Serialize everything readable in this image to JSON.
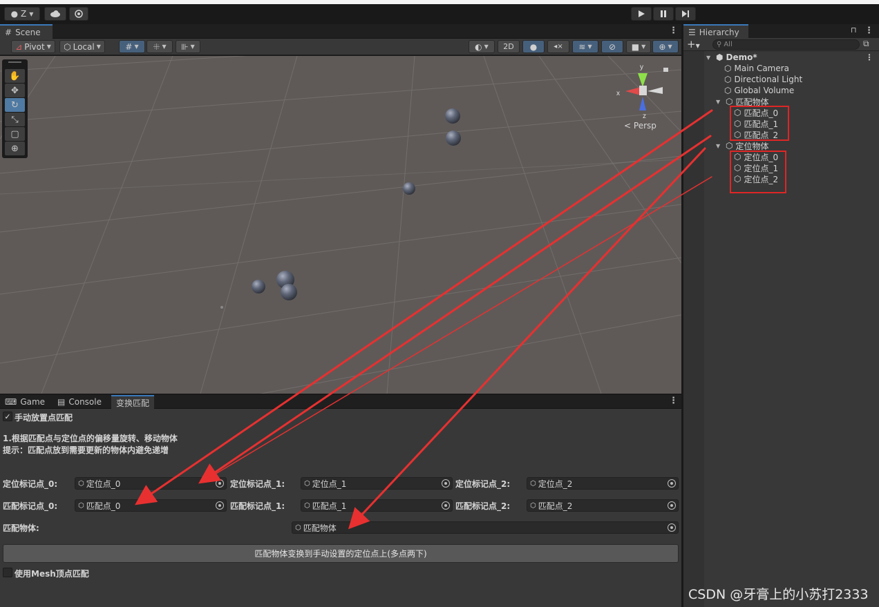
{
  "toolbar": {
    "account_label": "Z",
    "cloud_icon": "cloud-icon",
    "settings_icon": "gear-icon",
    "play_icon": "play-icon",
    "pause_icon": "pause-icon",
    "step_icon": "step-icon"
  },
  "scene_tab": {
    "label": "Scene"
  },
  "scene_toolbar": {
    "pivot_label": "Pivot",
    "local_label": "Local",
    "mode_2d_label": "2D"
  },
  "scene": {
    "gizmo_y": "y",
    "gizmo_x": "x",
    "gizmo_z": "z",
    "persp_label": "Persp"
  },
  "bottom_tabs": [
    {
      "label": "Game"
    },
    {
      "label": "Console"
    },
    {
      "label": "变换匹配"
    }
  ],
  "panel": {
    "manual_toggle_label": "手动放置点匹配",
    "manual_toggle_checked": true,
    "desc_line1": "1.根据匹配点与定位点的偏移量旋转、移动物体",
    "desc_line2": "提示：匹配点放到需要更新的物体内避免递增",
    "locate_row": [
      {
        "label": "定位标记点_0:",
        "value": "定位点_0"
      },
      {
        "label": "定位标记点_1:",
        "value": "定位点_1"
      },
      {
        "label": "定位标记点_2:",
        "value": "定位点_2"
      }
    ],
    "match_row": [
      {
        "label": "匹配标记点_0:",
        "value": "匹配点_0"
      },
      {
        "label": "匹配标记点_1:",
        "value": "匹配点_1"
      },
      {
        "label": "匹配标记点_2:",
        "value": "匹配点_2"
      }
    ],
    "match_object_label": "匹配物体:",
    "match_object_value": "匹配物体",
    "transform_button_label": "匹配物体变换到手动设置的定位点上(多点两下)",
    "mesh_toggle_label": "使用Mesh顶点匹配",
    "mesh_toggle_checked": false
  },
  "hierarchy": {
    "tab_label": "Hierarchy",
    "search_placeholder": "All",
    "scene_name": "Demo*",
    "items": [
      {
        "label": "Main Camera"
      },
      {
        "label": "Directional Light"
      },
      {
        "label": "Global Volume"
      },
      {
        "label": "匹配物体"
      },
      {
        "label": "匹配点_0"
      },
      {
        "label": "匹配点_1"
      },
      {
        "label": "匹配点_2"
      },
      {
        "label": "定位物体"
      },
      {
        "label": "定位点_0"
      },
      {
        "label": "定位点_1"
      },
      {
        "label": "定位点_2"
      }
    ]
  },
  "watermark": "CSDN @牙膏上的小苏打2333",
  "colors": {
    "accent": "#3a79bb",
    "annotation_red": "#e02525",
    "scene_bg": "#5f5a58",
    "panel_bg": "#383838"
  }
}
